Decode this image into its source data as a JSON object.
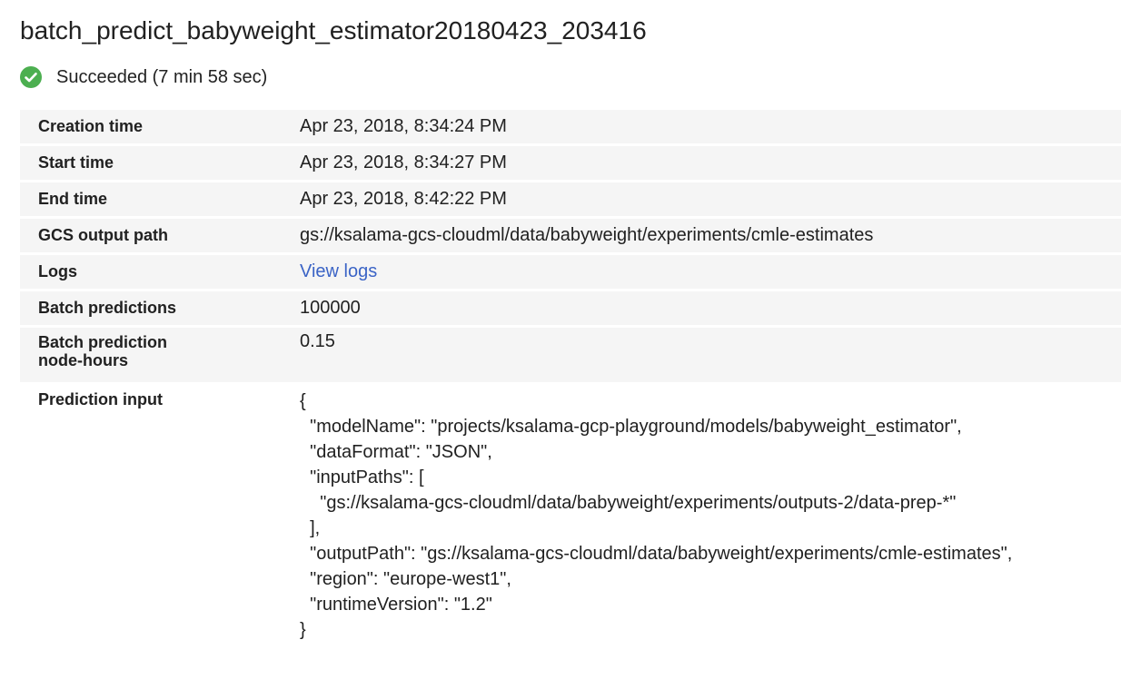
{
  "header": {
    "title": "batch_predict_babyweight_estimator20180423_203416"
  },
  "status": {
    "icon": "check-circle-icon",
    "color": "#4caf50",
    "text": "Succeeded (7 min 58 sec)"
  },
  "details": {
    "creation_time": {
      "label": "Creation time",
      "value": "Apr 23, 2018, 8:34:24 PM"
    },
    "start_time": {
      "label": "Start time",
      "value": "Apr 23, 2018, 8:34:27 PM"
    },
    "end_time": {
      "label": "End time",
      "value": "Apr 23, 2018, 8:42:22 PM"
    },
    "gcs_output_path": {
      "label": "GCS output path",
      "value": "gs://ksalama-gcs-cloudml/data/babyweight/experiments/cmle-estimates"
    },
    "logs": {
      "label": "Logs",
      "value": "View logs",
      "link_color": "#3b64c6"
    },
    "batch_predictions": {
      "label": "Batch predictions",
      "value": "100000"
    },
    "node_hours": {
      "label_line1": "Batch prediction",
      "label_line2": "node-hours",
      "value": "0.15"
    },
    "prediction_input": {
      "label": "Prediction input",
      "value": "{\n  \"modelName\": \"projects/ksalama-gcp-playground/models/babyweight_estimator\",\n  \"dataFormat\": \"JSON\",\n  \"inputPaths\": [\n    \"gs://ksalama-gcs-cloudml/data/babyweight/experiments/outputs-2/data-prep-*\"\n  ],\n  \"outputPath\": \"gs://ksalama-gcs-cloudml/data/babyweight/experiments/cmle-estimates\",\n  \"region\": \"europe-west1\",\n  \"runtimeVersion\": \"1.2\"\n}"
    }
  }
}
